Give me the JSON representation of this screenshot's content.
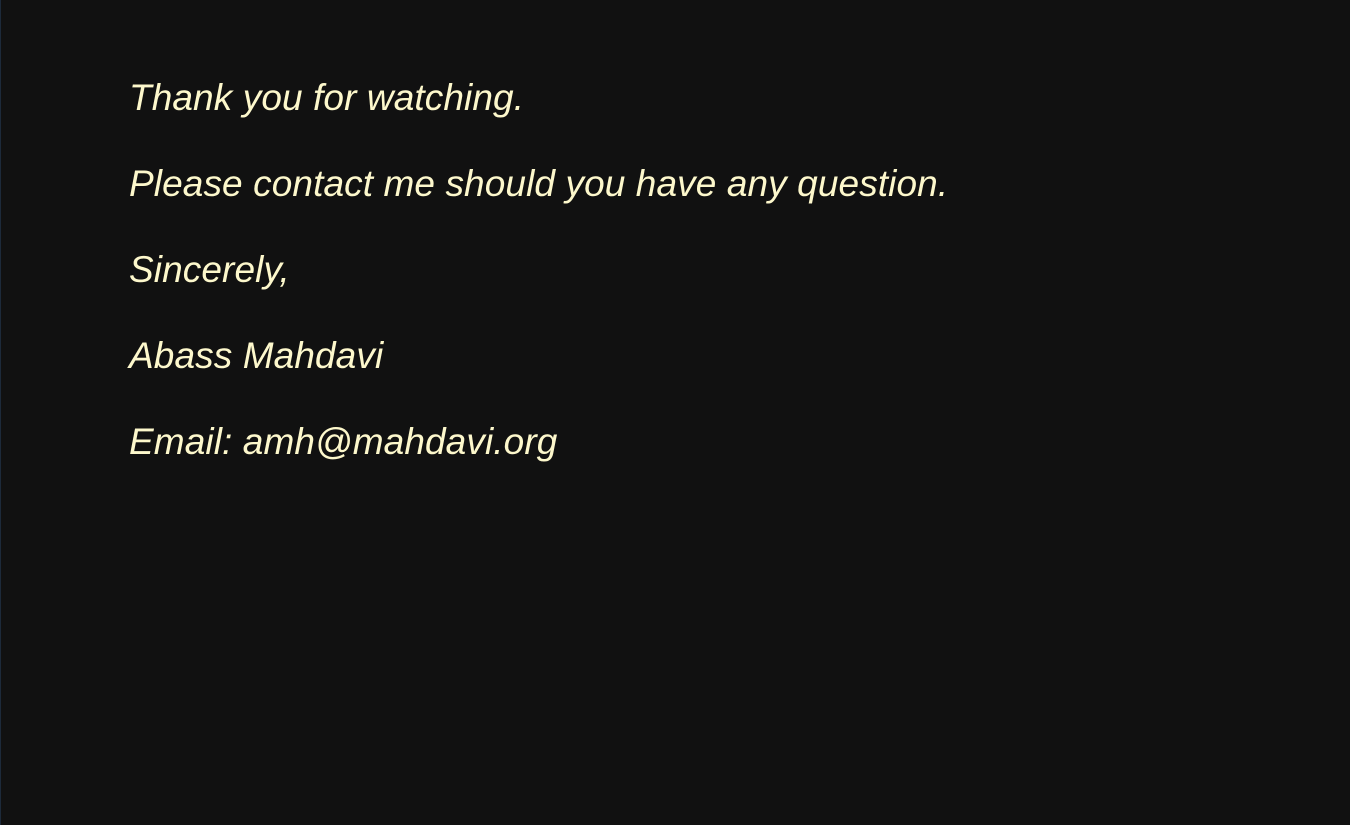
{
  "message": {
    "thanks": "Thank you for watching.",
    "contact_request": "Please contact me should you have any question.",
    "closing": "Sincerely,",
    "author": "Abass Mahdavi",
    "email_label": "Email: ",
    "email_address": "amh@mahdavi.org"
  },
  "colors": {
    "background": "#111111",
    "text": "#fdf8cc"
  }
}
